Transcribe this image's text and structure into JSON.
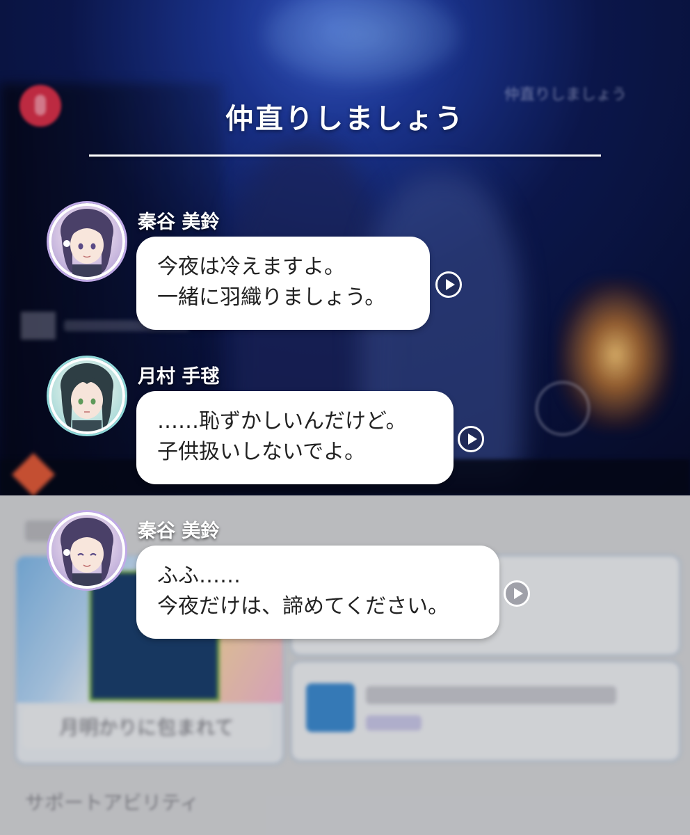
{
  "dialog": {
    "title": "仲直りしましょう",
    "messages": [
      {
        "speaker": "秦谷 美鈴",
        "lines": [
          "今夜は冷えますよ。",
          "一緒に羽織りましょう。"
        ],
        "avatar_icon": "character-avatar-icon"
      },
      {
        "speaker": "月村 手毬",
        "lines": [
          "……恥ずかしいんだけど。",
          "子供扱いしないでよ。"
        ],
        "avatar_icon": "character-avatar-icon"
      },
      {
        "speaker": "秦谷 美鈴",
        "lines": [
          "ふふ……",
          "今夜だけは、諦めてください。"
        ],
        "avatar_icon": "character-avatar-icon"
      }
    ]
  },
  "background": {
    "faint_title": "仲直りしましょう",
    "card_caption": "月明かりに包まれて",
    "section_label": "サポートアビリティ"
  },
  "colors": {
    "avatar_ring_purple": "#bfa9e6",
    "avatar_ring_teal": "#8fd8d8",
    "bubble": "#ffffff",
    "lower_panel": "#d4d5d9"
  }
}
